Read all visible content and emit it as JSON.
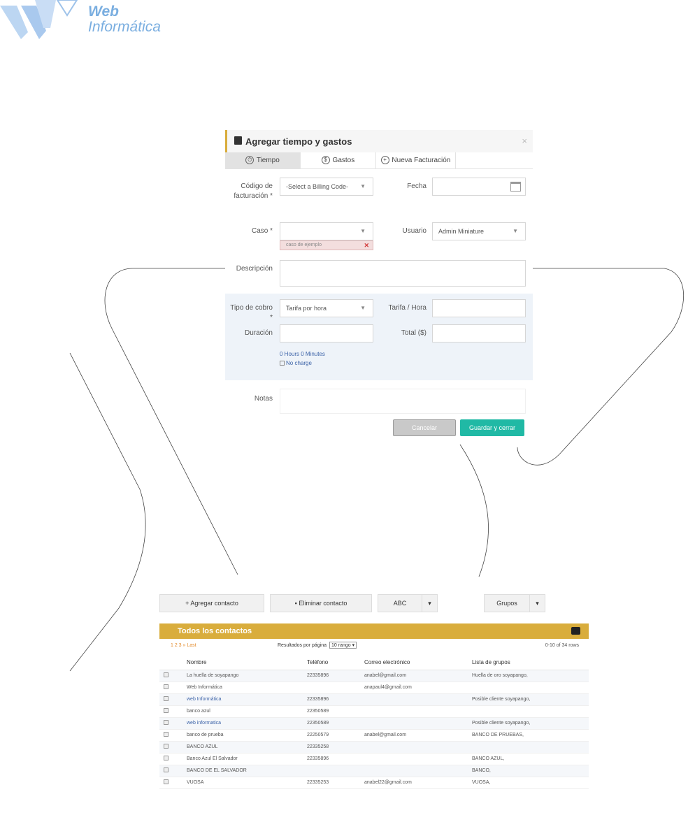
{
  "logo": {
    "line1": "Web",
    "line2": "Informática"
  },
  "modal": {
    "title": "Agregar tiempo y gastos",
    "close": "×",
    "tabs": [
      {
        "icon": "⏱",
        "label": "Tiempo"
      },
      {
        "icon": "$",
        "label": "Gastos"
      },
      {
        "icon": "+",
        "label": "Nueva Facturación"
      }
    ],
    "billing_code": {
      "label": "Código de facturación *",
      "value": "-Select a Billing Code-"
    },
    "date": {
      "label": "Fecha",
      "value": ""
    },
    "case": {
      "label": "Caso *",
      "value": "",
      "tag": "caso de ejemplo"
    },
    "user": {
      "label": "Usuario",
      "value": "Admin Miniature"
    },
    "description": {
      "label": "Descripción",
      "value": ""
    },
    "charge_type": {
      "label": "Tipo de cobro *",
      "value": "Tarifa por hora"
    },
    "rate": {
      "label": "Tarifa / Hora",
      "value": ""
    },
    "duration": {
      "label": "Duración",
      "value": ""
    },
    "total": {
      "label": "Total ($)",
      "value": ""
    },
    "hours_minutes_link": "0 Hours 0 Minutes",
    "no_charge": "No charge",
    "notes": {
      "label": "Notas",
      "value": ""
    },
    "cancel_label": "Cancelar",
    "save_label": "Guardar y cerrar"
  },
  "contacts": {
    "toolbar": {
      "add": "+ Agregar contacto",
      "delete": "Eliminar contacto",
      "abc": "ABC",
      "groups": "Grupos"
    },
    "title": "Todos los contactos",
    "pager": "1  2  3  »  Last",
    "per_page_label": "Resultados por página",
    "per_page_value": "10 rango",
    "row_count": "0-10 of 34 rows",
    "headers": [
      "Nombre",
      "Teléfono",
      "Correo electrónico",
      "Lista de grupos"
    ],
    "rows": [
      [
        "La huella de soyapango",
        "22335896",
        "anabel@gmail.com",
        "Huella de oro soyapango,"
      ],
      [
        "Web Informática",
        "",
        "anapaul4@gmail.com",
        ""
      ],
      [
        "web Informática",
        "22335896",
        "",
        "Posible cliente soyapango,"
      ],
      [
        "banco azul",
        "22350589",
        "",
        ""
      ],
      [
        "web informatica",
        "22350589",
        "",
        "Posible cliente soyapango,"
      ],
      [
        "banco de prueba",
        "22250579",
        "anabel@gmail.com",
        "BANCO DE PRUEBAS,"
      ],
      [
        "BANCO AZUL",
        "22335258",
        "",
        ""
      ],
      [
        "Banco Azul El Salvador",
        "22335896",
        "",
        "BANCO AZUL,"
      ],
      [
        "BANCO DE EL SALVADOR",
        "",
        "",
        "BANCO,"
      ],
      [
        "VUOSA",
        "22335253",
        "anabel22@gmail.com",
        "VUOSA,"
      ]
    ]
  },
  "colors": {
    "accent": "#d9ad3c",
    "save": "#20b9a5",
    "logo": "#7aaee0"
  }
}
